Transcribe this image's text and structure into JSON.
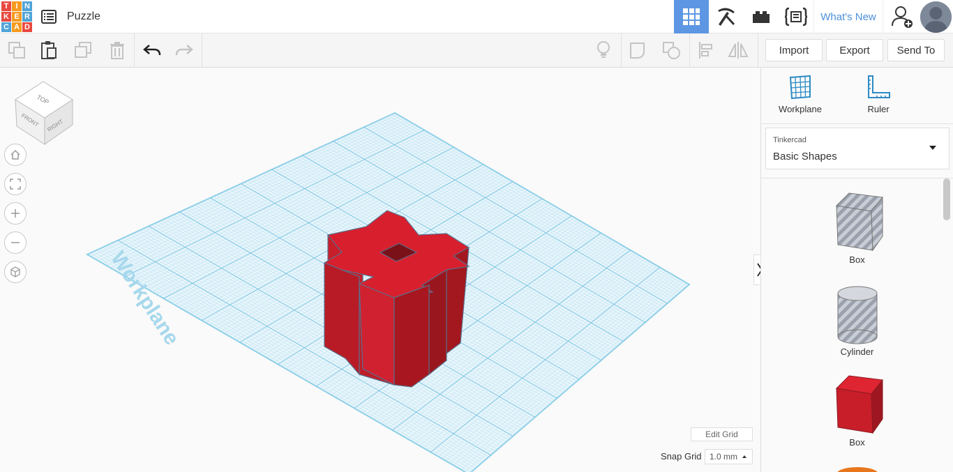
{
  "header": {
    "project_title": "Puzzle",
    "logo_letters": [
      "T",
      "I",
      "N",
      "K",
      "E",
      "R",
      "C",
      "A",
      "D"
    ],
    "logo_colors": [
      "#e8483f",
      "#f79a1f",
      "#4fa3d8",
      "#e8483f",
      "#f79a1f",
      "#4fa3d8",
      "#4fa3d8",
      "#f79a1f",
      "#e8483f"
    ],
    "whats_new": "What's New",
    "icons": [
      "grid-view-icon",
      "pickaxe-icon",
      "brick-icon",
      "codeblocks-icon"
    ],
    "accent": "#5d97e3"
  },
  "toolbar": {
    "import_label": "Import",
    "export_label": "Export",
    "send_to_label": "Send To"
  },
  "viewport": {
    "view_cube_top": "TOP",
    "view_cube_front": "FRONT",
    "view_cube_right": "RIGHT",
    "workplane_label": "Workplane",
    "edit_grid_label": "Edit Grid",
    "snap_grid_label": "Snap Grid",
    "snap_grid_value": "1.0 mm",
    "object_color": "#d81f2e"
  },
  "panel": {
    "workplane_label": "Workplane",
    "ruler_label": "Ruler",
    "library_source": "Tinkercad",
    "library_name": "Basic Shapes",
    "shapes": [
      {
        "label": "Box"
      },
      {
        "label": "Cylinder"
      },
      {
        "label": "Box"
      }
    ]
  }
}
